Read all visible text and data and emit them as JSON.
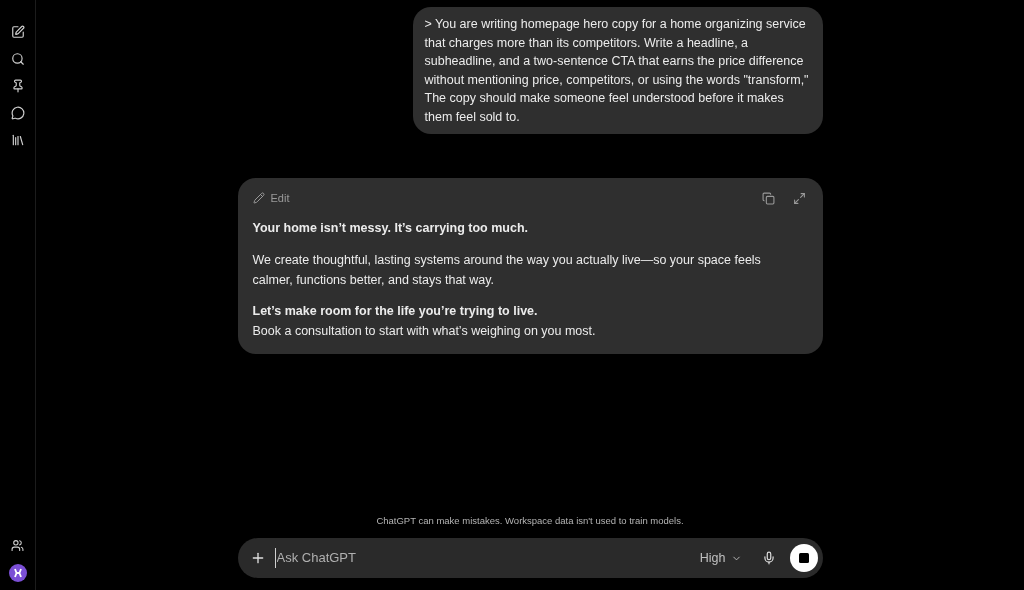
{
  "user_message": "> You are writing homepage hero copy for a home organizing service that charges more than its competitors. Write a headline, a subheadline, and a two-sentence CTA that earns the price difference without mentioning price, competitors, or using the words \"transform,\"  The copy should make someone feel understood before it makes them feel sold to.",
  "response_card": {
    "edit_label": "Edit",
    "headline": "Your home isn’t messy. It’s carrying too much.",
    "body": "We create thoughtful, lasting systems around the way you actually live—so your space feels calmer, functions better, and stays that way.",
    "cta_headline": "Let’s make room for the life you’re trying to live.",
    "cta_body": "Book a consultation to start with what’s weighing on you most."
  },
  "disclaimer": "ChatGPT can make mistakes. Workspace data isn't used to train models.",
  "composer": {
    "placeholder": "Ask ChatGPT",
    "model": "High"
  }
}
